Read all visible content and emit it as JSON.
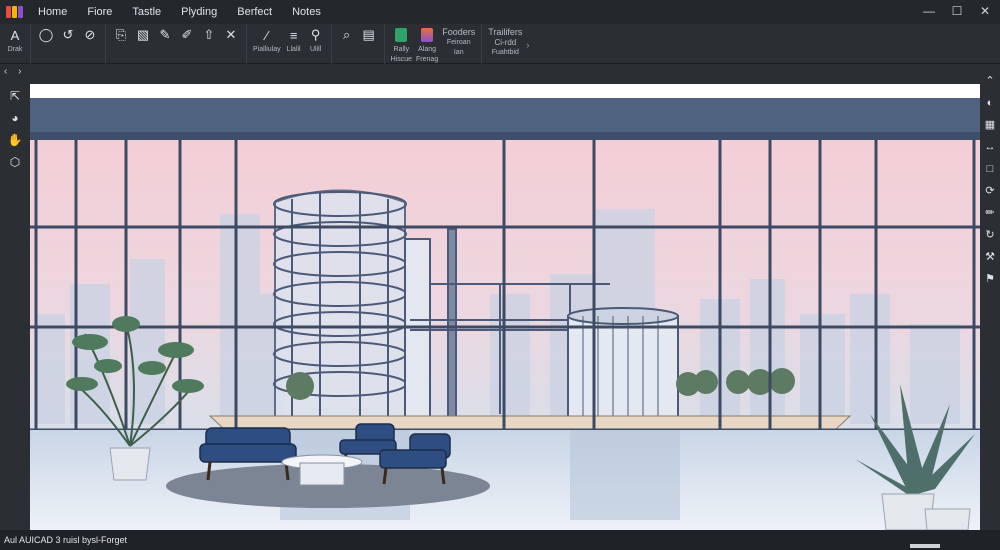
{
  "menubar": {
    "items": [
      "Home",
      "Fiore",
      "Tastle",
      "Plyding",
      "Berfect",
      "Notes"
    ]
  },
  "ribbon": {
    "draw_label": "Drak",
    "group2_labels": [
      "Pialliulay",
      "Llalil",
      "Ulill"
    ],
    "group3_labels": [
      "Rally",
      "Hiscue",
      "Alang",
      "Frenag",
      "Fooders",
      "Feiroan",
      "Ian"
    ],
    "group4_labels": [
      "Trailifers",
      "Ci-rdd",
      "Fuahtbid"
    ]
  },
  "statusbar": {
    "text": "Aul AUICAD 3 ruisl bysl-Forget"
  },
  "colors": {
    "bg": "#2b2e33",
    "sky_pink": "#f6d3da",
    "frame_slate": "#4a5a78",
    "sofa_blue": "#2e4d80"
  }
}
